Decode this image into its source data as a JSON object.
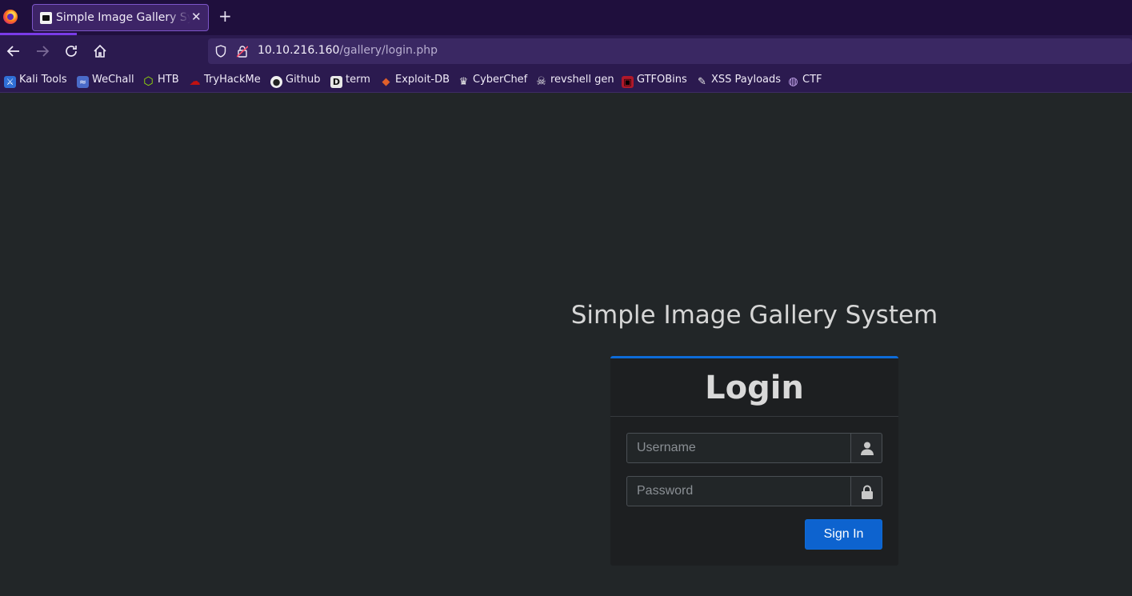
{
  "browser": {
    "tab": {
      "title": "Simple Image Gallery System"
    },
    "url": {
      "host": "10.10.216.160",
      "path": "/gallery/login.php"
    },
    "bookmarks": [
      {
        "label": "Kali Tools",
        "icon": "kali-icon",
        "color": "#2f6fd6"
      },
      {
        "label": "WeChall",
        "icon": "wechall-icon",
        "color": "#4a6bc8"
      },
      {
        "label": "HTB",
        "icon": "htb-cube-icon",
        "color": "#9fef00"
      },
      {
        "label": "TryHackMe",
        "icon": "tryhackme-icon",
        "color": "#c11111"
      },
      {
        "label": "Github",
        "icon": "github-icon",
        "color": "#f0f0f0"
      },
      {
        "label": "term",
        "icon": "term-icon",
        "color": "#e8e8e8"
      },
      {
        "label": "Exploit-DB",
        "icon": "exploitdb-icon",
        "color": "#e0602a"
      },
      {
        "label": "CyberChef",
        "icon": "chef-hat-icon",
        "color": "#e8e8e8"
      },
      {
        "label": "revshell gen",
        "icon": "skull-icon",
        "color": "#e8e8e8"
      },
      {
        "label": "GTFOBins",
        "icon": "gtfobins-icon",
        "color": "#b0182a"
      },
      {
        "label": "XSS Payloads",
        "icon": "xss-icon",
        "color": "#e8e8e8"
      },
      {
        "label": "CTF",
        "icon": "globe-icon",
        "color": "#c8a8f0"
      }
    ]
  },
  "page": {
    "site_title": "Simple Image Gallery System",
    "login": {
      "heading": "Login",
      "username_placeholder": "Username",
      "password_placeholder": "Password",
      "signin_label": "Sign In"
    }
  }
}
